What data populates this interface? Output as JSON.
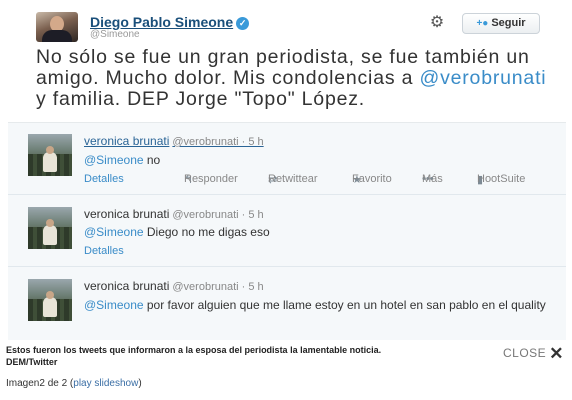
{
  "main_tweet": {
    "name": "Diego Pablo Simeone",
    "handle": "@Simeone",
    "follow_label": "Seguir",
    "text_before": "No sólo se fue un gran periodista, se fue también un amigo. Mucho dolor. Mis condolencias a ",
    "mention": "@verobrunati",
    "text_after": " y familia. DEP Jorge \"Topo\" López."
  },
  "actions": {
    "detalles": "Detalles",
    "responder": "Responder",
    "retwittear": "Retwittear",
    "favorito": "Favorito",
    "mas": "Más",
    "hootsuite": "HootSuite"
  },
  "replies": [
    {
      "name": "veronica brunati",
      "handle": "@verobrunati · 5 h",
      "mention": "@Simeone",
      "text": " no"
    },
    {
      "name": "veronica brunati",
      "handle": "@verobrunati · 5 h",
      "mention": "@Simeone",
      "text": " Diego no me digas eso"
    },
    {
      "name": "veronica brunati",
      "handle": "@verobrunati · 5 h",
      "mention": "@Simeone",
      "text": " por favor alguien que me llame estoy en un hotel en san pablo en el quality"
    }
  ],
  "caption": {
    "text": "Estos fueron los tweets que informaron a la esposa del periodista la lamentable noticia. DEM/Twitter",
    "close_label": "CLOSE",
    "counter_prefix": "Imagen2 de 2 (",
    "slideshow_link": "play slideshow",
    "counter_suffix": ")"
  },
  "colors": {
    "link": "#3a8cc8",
    "name": "#1a4f7a",
    "panel_bg": "#f5f8fa"
  }
}
